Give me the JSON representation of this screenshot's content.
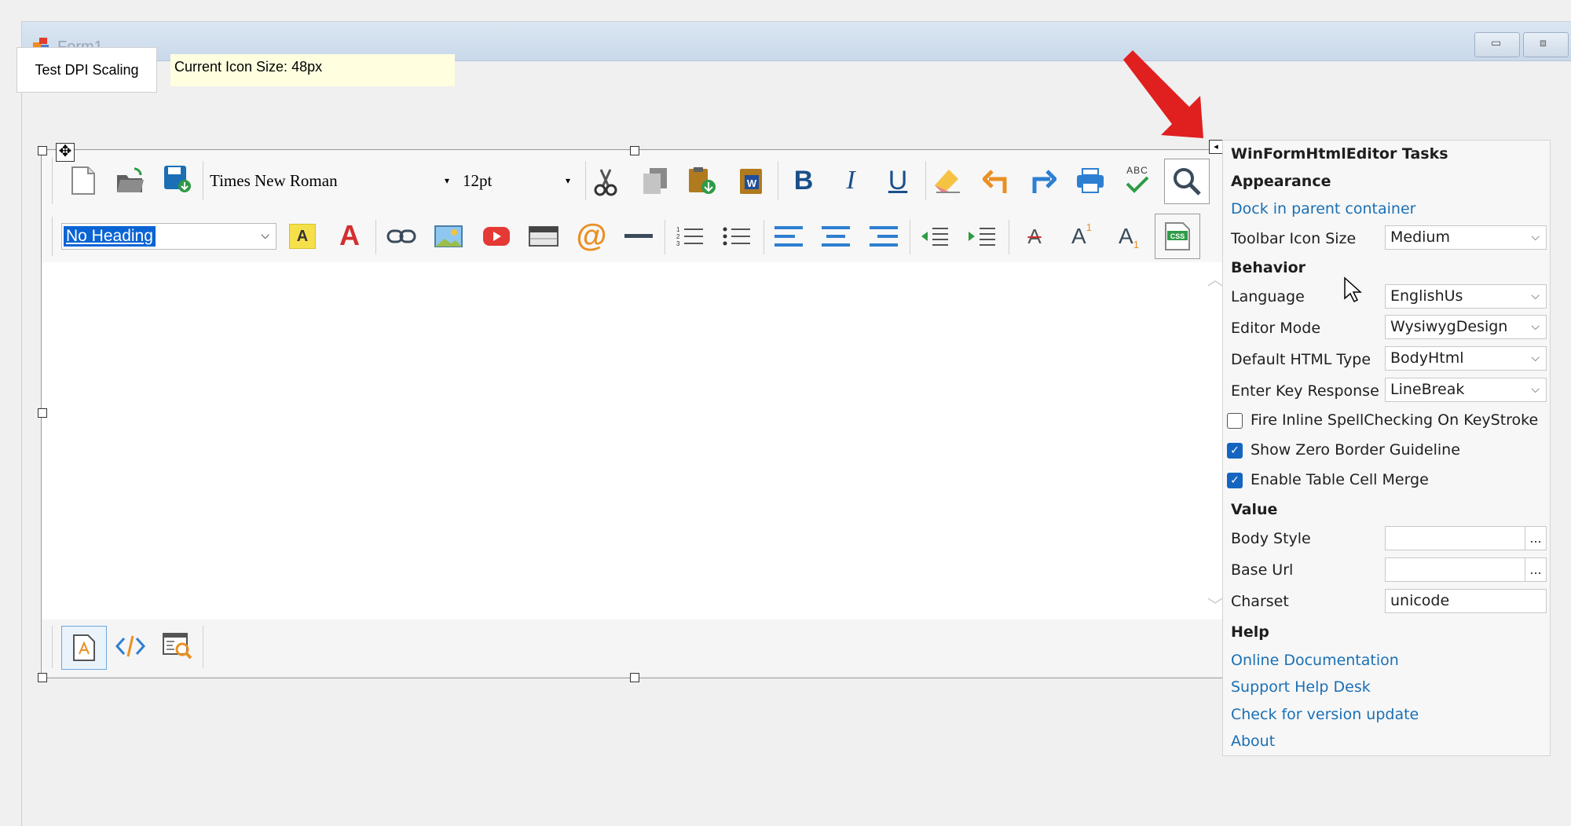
{
  "window": {
    "title": "Form1",
    "minimize_glyph": "▭",
    "maximize_glyph": "⧈"
  },
  "top": {
    "test_button_label": "Test DPI Scaling",
    "icon_size_text": "Current Icon Size: 48px"
  },
  "toolbar": {
    "font_name": "Times New Roman",
    "font_size": "12pt",
    "heading": "No Heading",
    "dropdown_glyph": "▾",
    "bold": "B",
    "italic": "I",
    "underline": "U",
    "spell_label": "ABC",
    "highlight_letter": "A",
    "font_color_letter": "A",
    "superscript_letter": "A",
    "superscript_mark": "1",
    "subscript_letter": "A",
    "subscript_mark": "1",
    "css_label": "CSS",
    "at_glyph": "@",
    "strike_letter": "A",
    "word_letter": "W"
  },
  "tasks": {
    "title": "WinFormHtmlEditor Tasks",
    "appearance": {
      "heading": "Appearance",
      "dock_link": "Dock in parent container",
      "icon_size_label": "Toolbar Icon Size",
      "icon_size_value": "Medium"
    },
    "behavior": {
      "heading": "Behavior",
      "language_label": "Language",
      "language_value": "EnglishUs",
      "editor_mode_label": "Editor Mode",
      "editor_mode_value": "WysiwygDesign",
      "html_type_label": "Default HTML Type",
      "html_type_value": "BodyHtml",
      "enter_key_label": "Enter Key Response",
      "enter_key_value": "LineBreak",
      "spellcheck_label": "Fire Inline SpellChecking On KeyStroke",
      "spellcheck_checked": false,
      "zero_border_label": "Show Zero Border Guideline",
      "zero_border_checked": true,
      "cell_merge_label": "Enable Table Cell Merge",
      "cell_merge_checked": true
    },
    "value": {
      "heading": "Value",
      "body_style_label": "Body Style",
      "body_style_value": "",
      "base_url_label": "Base Url",
      "base_url_value": "",
      "charset_label": "Charset",
      "charset_value": "unicode",
      "ellipsis": "..."
    },
    "help": {
      "heading": "Help",
      "online_docs": "Online Documentation",
      "support": "Support Help Desk",
      "version": "Check for version update",
      "about": "About"
    },
    "chevron_glyph": "⌵",
    "check_glyph": "✓"
  },
  "colors": {
    "accent_blue": "#1a6fb5",
    "selection_blue": "#0a64d4",
    "red": "#d32f2f",
    "checkbox_blue": "#1565c0"
  }
}
